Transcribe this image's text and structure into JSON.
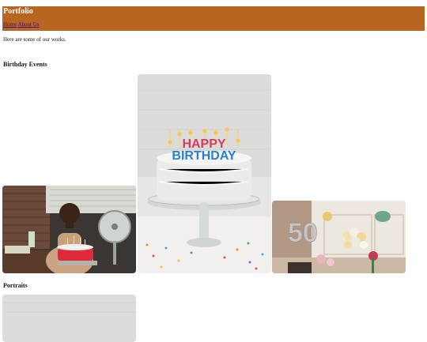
{
  "header": {
    "title": "Portfolio",
    "nav": [
      "Home",
      "About Us"
    ]
  },
  "main": {
    "intro": "Here are some of our works.",
    "sections": [
      {
        "title": "Birthday Events",
        "photos": [
          {
            "subject": "Boy holding a red birthday cake with candles"
          },
          {
            "subject": "White frosted cake on a glass stand with colorful HAPPY BIRTHDAY candles",
            "cake_text": [
              "HAPPY",
              "BIRTHDAY"
            ]
          },
          {
            "subject": "Party room with a 50 balloon, balloon arch and flowers",
            "balloon_text": "50"
          }
        ]
      },
      {
        "title": "Portraits",
        "photos": [
          {
            "subject": "Light gray portrait photo (cropped)"
          }
        ]
      }
    ]
  },
  "colors": {
    "header_bg": "#b7651f",
    "title_text": "#ffffff",
    "link": "#3a0a9a"
  }
}
